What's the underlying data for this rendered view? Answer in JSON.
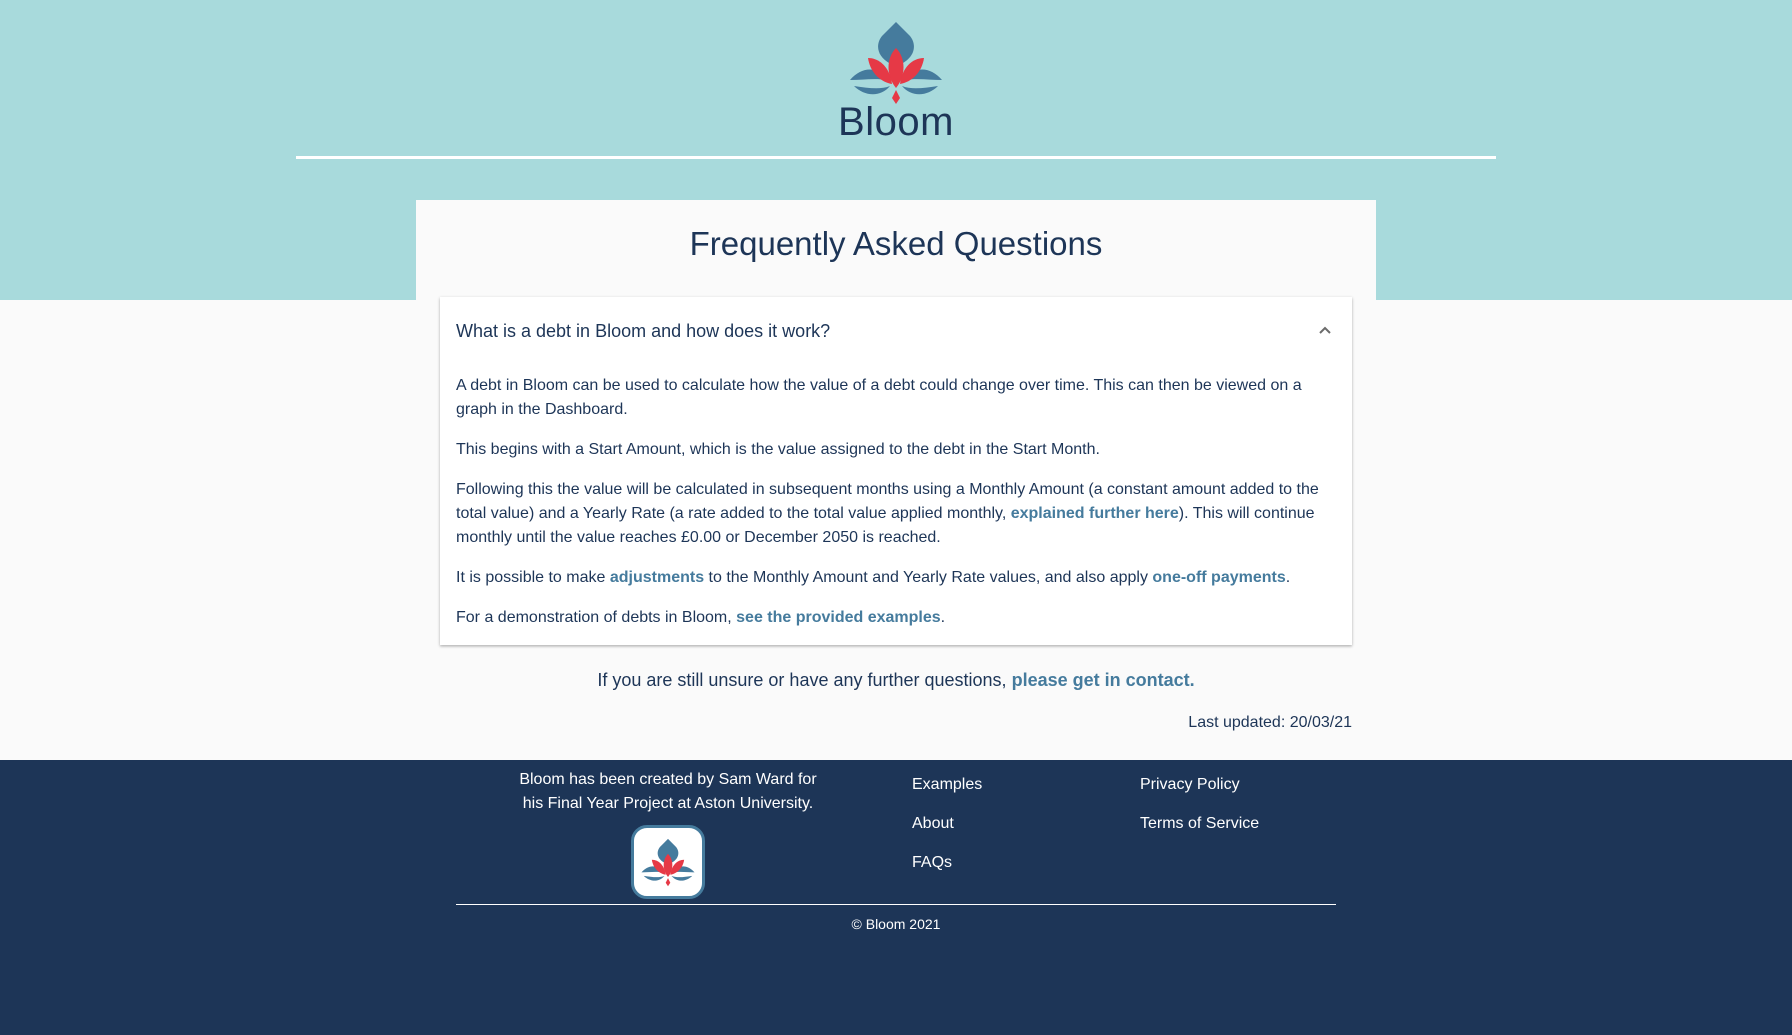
{
  "header": {
    "brand": "Bloom",
    "logo_icon": "lotus-logo-icon"
  },
  "faq": {
    "title": "Frequently Asked Questions",
    "question": "What is a debt in Bloom and how does it work?",
    "expanded": true,
    "p1": "A debt in Bloom can be used to calculate how the value of a debt could change over time. This can then be viewed on a graph in the Dashboard.",
    "p2": "This begins with a Start Amount, which is the value assigned to the debt in the Start Month.",
    "p3_a": "Following this the value will be calculated in subsequent months using a Monthly Amount (a constant amount added to the total value) and a Yearly Rate (a rate added to the total value applied monthly, ",
    "p3_link": "explained further here",
    "p3_b": "). This will continue monthly until the value reaches £0.00 or December 2050 is reached.",
    "p4_a": "It is possible to make ",
    "p4_link1": "adjustments",
    "p4_b": " to the Monthly Amount and Yearly Rate values, and also apply ",
    "p4_link2": "one-off payments",
    "p4_c": ".",
    "p5_a": "For a demonstration of debts in Bloom, ",
    "p5_link": "see the provided examples",
    "p5_b": "."
  },
  "contact": {
    "text": "If you are still unsure or have any further questions, ",
    "link": "please get in contact."
  },
  "last_updated": "Last updated: 20/03/21",
  "footer": {
    "credit_line1": "Bloom has been created by Sam Ward for",
    "credit_line2": "his Final Year Project at Aston University.",
    "links_col1": [
      "Examples",
      "About",
      "FAQs"
    ],
    "links_col2": [
      "Privacy Policy",
      "Terms of Service"
    ],
    "copyright": "© Bloom 2021"
  },
  "colors": {
    "band": "#a8dadc",
    "navy": "#1d3557",
    "link": "#457b9d",
    "accent_red": "#e63946"
  }
}
